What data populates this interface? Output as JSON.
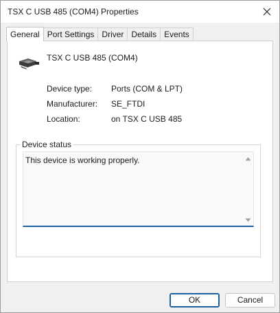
{
  "window": {
    "title": "TSX C USB 485 (COM4) Properties",
    "close_icon": "close-icon"
  },
  "tabs": [
    {
      "label": "General",
      "active": true
    },
    {
      "label": "Port Settings",
      "active": false
    },
    {
      "label": "Driver",
      "active": false
    },
    {
      "label": "Details",
      "active": false
    },
    {
      "label": "Events",
      "active": false
    }
  ],
  "device": {
    "name": "TSX C USB 485 (COM4)",
    "icon": "serial-port-icon",
    "properties": [
      {
        "label": "Device type:",
        "value": "Ports (COM & LPT)"
      },
      {
        "label": "Manufacturer:",
        "value": "SE_FTDI"
      },
      {
        "label": "Location:",
        "value": "on TSX C USB 485"
      }
    ]
  },
  "device_status": {
    "title": "Device status",
    "text": "This device is working properly."
  },
  "buttons": {
    "ok_label": "OK",
    "cancel_label": "Cancel"
  },
  "colors": {
    "accent": "#1a5f9e",
    "window_bg": "#f0f0f0",
    "panel_bg": "#ffffff"
  }
}
